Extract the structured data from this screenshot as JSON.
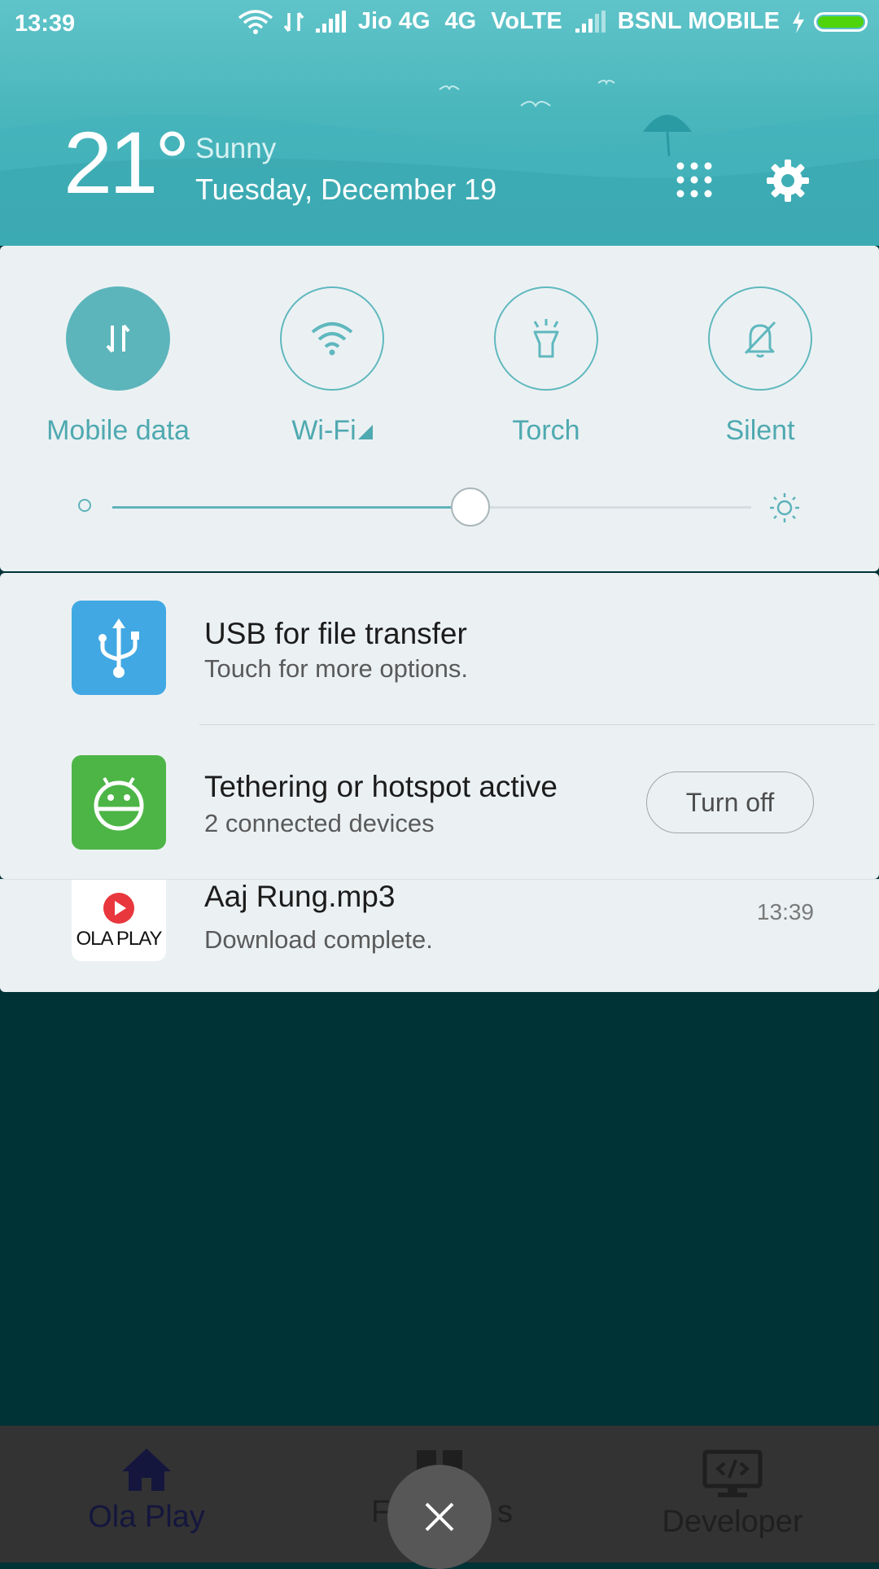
{
  "status_bar": {
    "time": "13:39",
    "carrier1": "Jio 4G",
    "network_type": "4G",
    "volte": "VoLTE",
    "carrier2": "BSNL MOBILE",
    "battery_color": "#4fd40c"
  },
  "weather": {
    "temperature": "21°",
    "condition": "Sunny",
    "date": "Tuesday, December 19"
  },
  "quick_settings": {
    "tiles": [
      {
        "label": "Mobile data",
        "icon": "mobile-data-icon",
        "active": true
      },
      {
        "label": "Wi-Fi",
        "icon": "wifi-icon",
        "active": false
      },
      {
        "label": "Torch",
        "icon": "flashlight-icon",
        "active": false
      },
      {
        "label": "Silent",
        "icon": "bell-off-icon",
        "active": false
      }
    ],
    "brightness": 0.56
  },
  "notifications": [
    {
      "app_icon": "usb-icon",
      "title": "USB for file transfer",
      "text": "Touch for more options."
    },
    {
      "app_icon": "android-hotspot-icon",
      "title": "Tethering or hotspot active",
      "text": "2 connected devices",
      "action": "Turn off"
    },
    {
      "app_icon": "ola-play-logo",
      "app_logo_text": "OLA PLAY",
      "title": "Aaj Rung.mp3",
      "text": "Download complete.",
      "time": "13:39"
    }
  ],
  "bottom_nav": {
    "items": [
      {
        "label": "Ola Play",
        "icon": "home-icon"
      },
      {
        "label": "F",
        "label_tail": "s",
        "icon": "grid-icon"
      },
      {
        "label": "Developer",
        "icon": "developer-monitor-icon"
      }
    ]
  },
  "colors": {
    "accent": "#5cb5bb",
    "panel": "#ebf1f3",
    "background": "#003336"
  }
}
